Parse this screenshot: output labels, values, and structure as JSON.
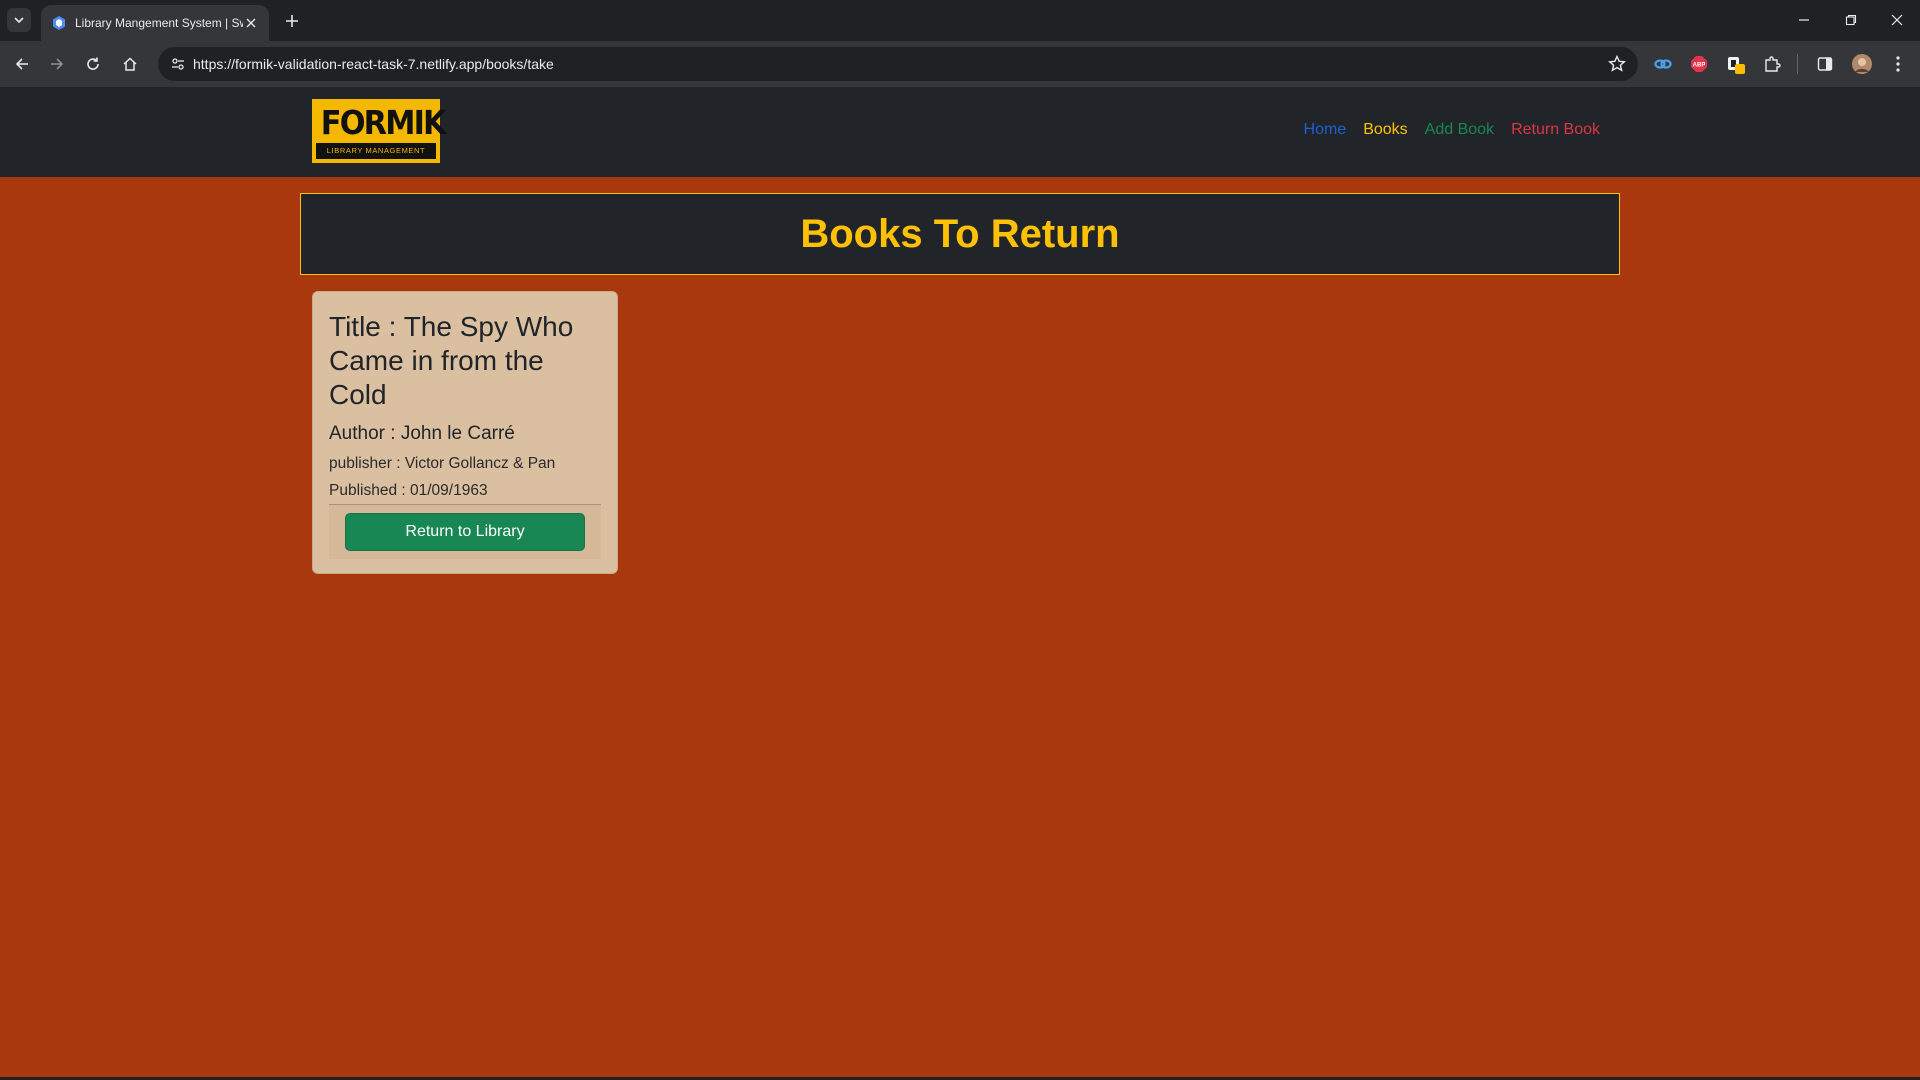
{
  "browser": {
    "tab_title": "Library Mangement System | Sw",
    "url": "https://formik-validation-react-task-7.netlify.app/books/take",
    "extension_abp_label": "ABP"
  },
  "logo": {
    "word": "FORMIK",
    "subtitle": "LIBRARY MANAGEMENT"
  },
  "nav": {
    "links": [
      {
        "label": "Home",
        "color": "#1f5fd1"
      },
      {
        "label": "Books",
        "color": "#ffc107"
      },
      {
        "label": "Add Book",
        "color": "#198754"
      },
      {
        "label": "Return Book",
        "color": "#dc3545"
      }
    ]
  },
  "page": {
    "heading": "Books To Return",
    "background_color": "#a9380f"
  },
  "books": [
    {
      "title": "Title : The Spy Who Came in from the Cold",
      "author": "Author : John le Carré",
      "publisher": "publisher : Victor Gollancz & Pan",
      "published": "Published : 01/09/1963",
      "button_label": "Return to Library"
    }
  ]
}
